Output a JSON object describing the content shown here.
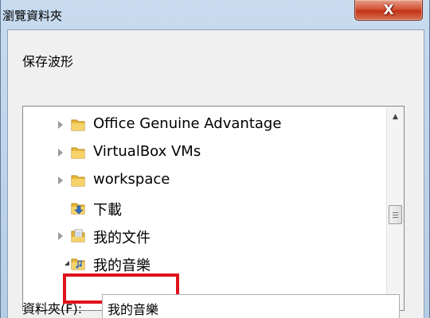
{
  "window": {
    "title": "瀏覽資料夾",
    "close_label": "X"
  },
  "dialog": {
    "description": "保存波形"
  },
  "tree": {
    "items": [
      {
        "label": "Office Genuine Advantage",
        "icon": "folder-icon",
        "expandable": true
      },
      {
        "label": "VirtualBox VMs",
        "icon": "folder-icon",
        "expandable": true
      },
      {
        "label": "workspace",
        "icon": "folder-icon",
        "expandable": true
      },
      {
        "label": "下載",
        "icon": "downloads-folder-icon",
        "expandable": false
      },
      {
        "label": "我的文件",
        "icon": "documents-folder-icon",
        "expandable": true
      },
      {
        "label": "我的音樂",
        "icon": "music-folder-icon",
        "expandable": true,
        "expanded": true,
        "selected": true
      }
    ]
  },
  "folder_field": {
    "label": "資料夾(F):",
    "value": "我的音樂"
  },
  "colors": {
    "highlight_border": "#e0121b",
    "folder_yellow": "#f0c84a"
  }
}
